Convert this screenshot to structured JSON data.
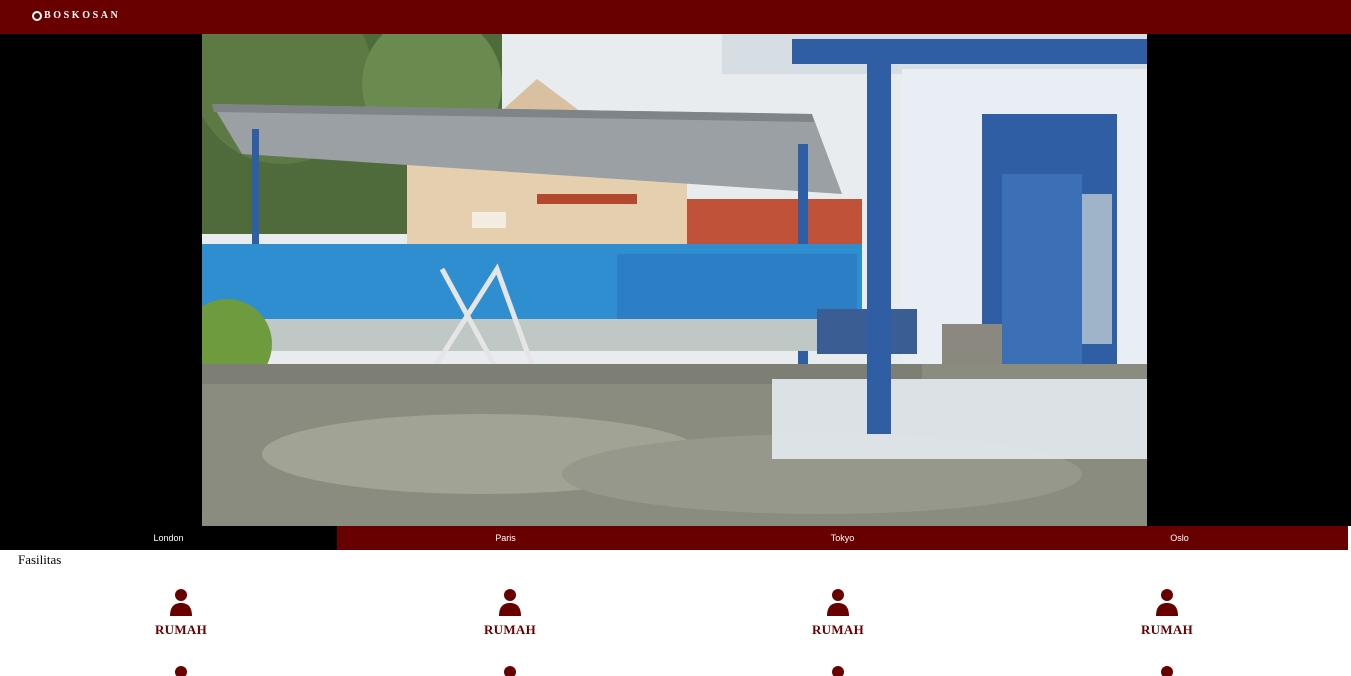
{
  "header": {
    "brand": "BOSKOSAN"
  },
  "hero": {
    "photo_alt": "Courtyard with blue fence and covered carport"
  },
  "tabs": [
    {
      "label": "London",
      "active": true
    },
    {
      "label": "Paris",
      "active": false
    },
    {
      "label": "Tokyo",
      "active": false
    },
    {
      "label": "Oslo",
      "active": false
    }
  ],
  "facilities": {
    "title": "Fasilitas",
    "items": [
      {
        "label": "RUMAH",
        "icon": "person-icon"
      },
      {
        "label": "RUMAH",
        "icon": "person-icon"
      },
      {
        "label": "RUMAH",
        "icon": "person-icon"
      },
      {
        "label": "RUMAH",
        "icon": "person-icon"
      },
      {
        "label": "",
        "icon": "person-icon"
      },
      {
        "label": "",
        "icon": "person-icon"
      },
      {
        "label": "",
        "icon": "person-icon"
      },
      {
        "label": "",
        "icon": "person-icon"
      }
    ]
  },
  "colors": {
    "brand": "#690000",
    "hero_bg": "#000000"
  }
}
